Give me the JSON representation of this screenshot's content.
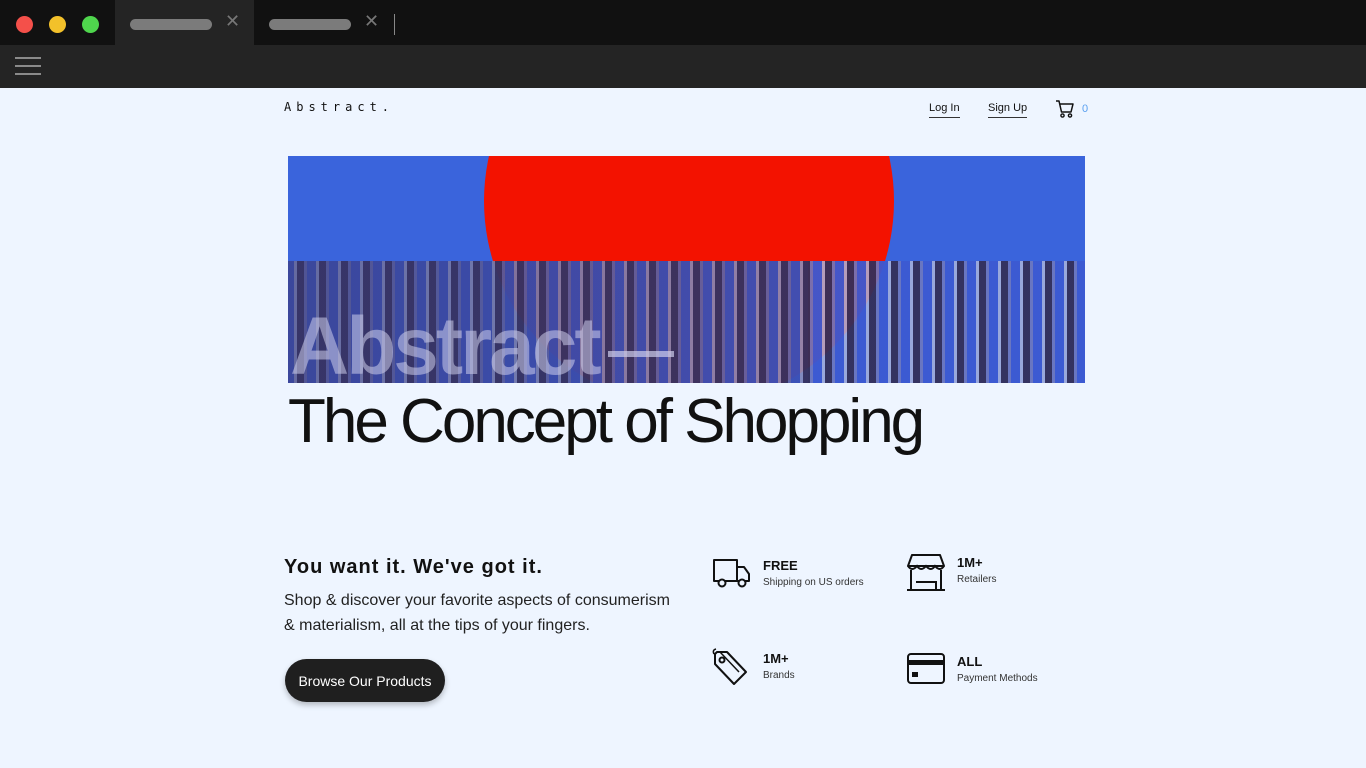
{
  "nav": {
    "logo": "Abstract.",
    "login": "Log In",
    "signup": "Sign Up",
    "cart_count": "0"
  },
  "hero": {
    "overlay_text": "Abstract",
    "headline": "The Concept of Shopping"
  },
  "intro": {
    "tagline": "You want it. We've got it.",
    "description": "Shop & discover your favorite aspects of consumerism & materialism, all at the tips of your fingers.",
    "cta_label": "Browse Our Products"
  },
  "features": [
    {
      "icon": "truck-icon",
      "title": "FREE",
      "subtitle": "Shipping on US orders"
    },
    {
      "icon": "store-icon",
      "title": "1M+",
      "subtitle": "Retailers"
    },
    {
      "icon": "tag-icon",
      "title": "1M+",
      "subtitle": "Brands"
    },
    {
      "icon": "credit-card-icon",
      "title": "ALL",
      "subtitle": "Payment Methods"
    }
  ],
  "colors": {
    "page_bg": "#eef5ff",
    "hero_blue": "#3a64dc",
    "hero_red": "#f31200",
    "cart_count": "#5aa0f0",
    "button": "#1f1f1f"
  }
}
